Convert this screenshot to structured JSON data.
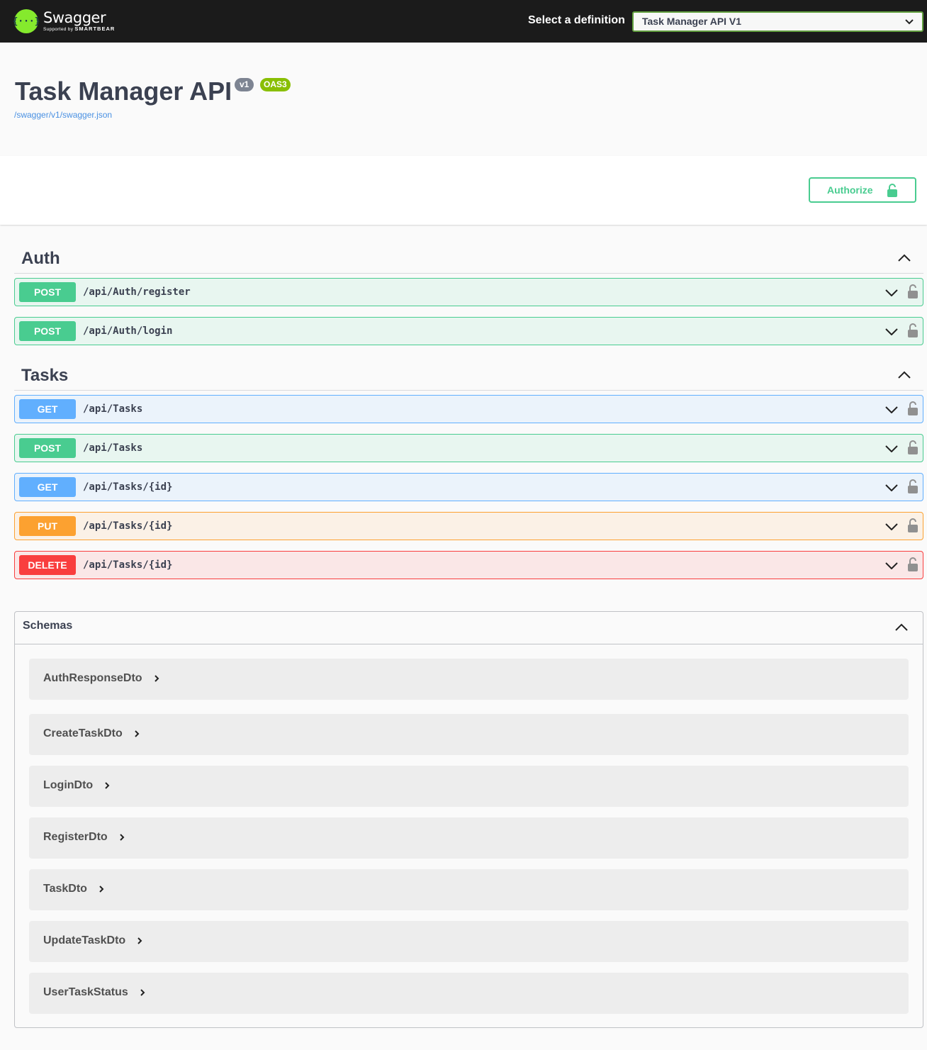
{
  "header": {
    "logo_name": "Swagger",
    "logo_sub_prefix": "Supported by",
    "logo_sub_brand": "SMARTBEAR",
    "logo_mark": "{···}",
    "definition_label": "Select a definition",
    "definition_selected": "Task Manager API V1"
  },
  "info": {
    "title": "Task Manager API",
    "version_badge": "v1",
    "oas_badge": "OAS3",
    "spec_url": "/swagger/v1/swagger.json"
  },
  "authorize": {
    "label": "Authorize",
    "icon": "unlocked-lock-icon"
  },
  "tags": [
    {
      "name": "Auth",
      "operations": [
        {
          "method": "POST",
          "path": "/api/Auth/register"
        },
        {
          "method": "POST",
          "path": "/api/Auth/login"
        }
      ]
    },
    {
      "name": "Tasks",
      "operations": [
        {
          "method": "GET",
          "path": "/api/Tasks"
        },
        {
          "method": "POST",
          "path": "/api/Tasks"
        },
        {
          "method": "GET",
          "path": "/api/Tasks/{id}"
        },
        {
          "method": "PUT",
          "path": "/api/Tasks/{id}"
        },
        {
          "method": "DELETE",
          "path": "/api/Tasks/{id}"
        }
      ]
    }
  ],
  "schemas": {
    "title": "Schemas",
    "models": [
      "AuthResponseDto",
      "CreateTaskDto",
      "LoginDto",
      "RegisterDto",
      "TaskDto",
      "UpdateTaskDto",
      "UserTaskStatus"
    ]
  },
  "colors": {
    "post": "#49cc90",
    "get": "#61affe",
    "put": "#fca130",
    "delete": "#f93e3e",
    "topbar": "#1b1b1b",
    "logo": "#85ea2d"
  }
}
